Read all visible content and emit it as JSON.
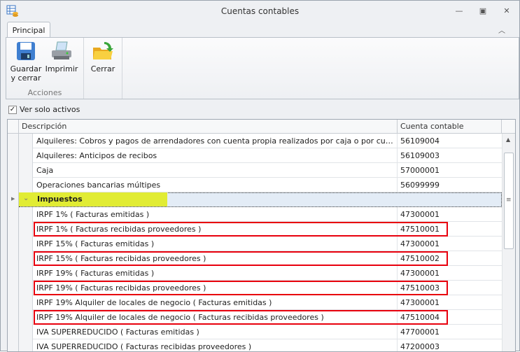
{
  "window": {
    "title": "Cuentas contables"
  },
  "ribbon": {
    "tab": "Principal",
    "groups": [
      {
        "label": "Acciones",
        "buttons": [
          {
            "label_line1": "Guardar",
            "label_line2": "y cerrar"
          },
          {
            "label_line1": "Imprimir",
            "label_line2": ""
          }
        ]
      },
      {
        "label": "",
        "buttons": [
          {
            "label_line1": "Cerrar",
            "label_line2": ""
          }
        ]
      }
    ]
  },
  "filter": {
    "label": "Ver solo activos",
    "checked": true
  },
  "grid": {
    "columns": [
      "Descripción",
      "Cuenta contable"
    ],
    "rows_before": [
      {
        "desc": "Alquileres: Cobros y pagos de arrendadores con cuenta propia realizados por caja o por cuenta del administrador",
        "account": "56109004"
      },
      {
        "desc": "Alquileres: Anticipos de recibos",
        "account": "56109003"
      },
      {
        "desc": "Caja",
        "account": "57000001"
      },
      {
        "desc": "Operaciones bancarias múltipes",
        "account": "56099999"
      }
    ],
    "group": {
      "label": "Impuestos"
    },
    "rows_after": [
      {
        "desc": "IRPF 1% ( Facturas emitidas )",
        "account": "47300001",
        "highlight": false
      },
      {
        "desc": "IRPF 1% ( Facturas recibidas proveedores )",
        "account": "47510001",
        "highlight": true
      },
      {
        "desc": "IRPF 15% ( Facturas emitidas )",
        "account": "47300001",
        "highlight": false
      },
      {
        "desc": "IRPF 15% ( Facturas recibidas proveedores )",
        "account": "47510002",
        "highlight": true
      },
      {
        "desc": "IRPF 19% ( Facturas emitidas )",
        "account": "47300001",
        "highlight": false
      },
      {
        "desc": "IRPF 19% ( Facturas recibidas proveedores )",
        "account": "47510003",
        "highlight": true
      },
      {
        "desc": "IRPF 19% Alquiler de locales de negocio ( Facturas emitidas )",
        "account": "47300001",
        "highlight": false
      },
      {
        "desc": "IRPF 19% Alquiler de locales de negocio ( Facturas recibidas proveedores )",
        "account": "47510004",
        "highlight": true
      },
      {
        "desc": "IVA SUPERREDUCIDO ( Facturas emitidas )",
        "account": "47700001",
        "highlight": false
      },
      {
        "desc": "IVA SUPERREDUCIDO ( Facturas recibidas proveedores )",
        "account": "47200003",
        "highlight": false
      }
    ]
  },
  "colors": {
    "highlight_border": "#e8000d",
    "group_label_bg": "#e1ec34",
    "group_row_bg": "#e3ecf6"
  }
}
